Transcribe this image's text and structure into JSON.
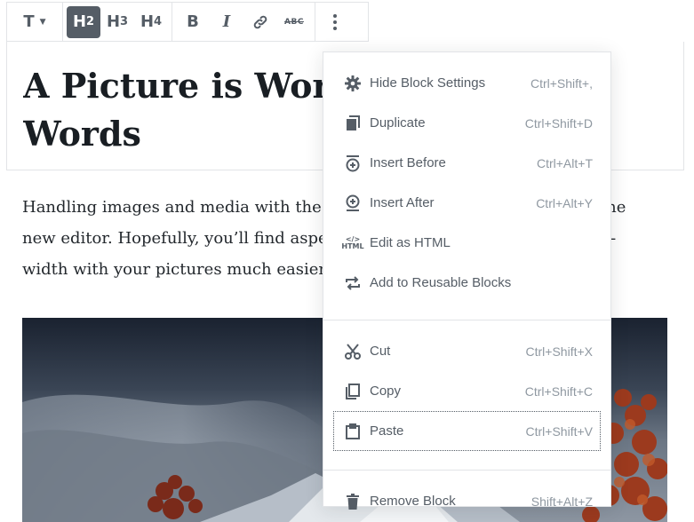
{
  "toolbar": {
    "block_type_label": "T",
    "heading_levels": [
      {
        "letter": "H",
        "level": "2",
        "active": true
      },
      {
        "letter": "H",
        "level": "3",
        "active": false
      },
      {
        "letter": "H",
        "level": "4",
        "active": false
      }
    ],
    "bold_label": "B",
    "italic_label": "I",
    "strikethrough_label": "ABC"
  },
  "heading": {
    "line1": "A Picture is Worth a Thousand",
    "line2": "Words"
  },
  "paragraph": {
    "line1": "Handling images and media with the utmost care is a primary focus of the",
    "line2": "new editor. Hopefully, you’ll find aspects of adding captions or going full-",
    "line3": "width with your pictures much easier and robust than before."
  },
  "menu": {
    "sections": [
      [
        {
          "icon": "gear-icon",
          "label": "Hide Block Settings",
          "shortcut": "Ctrl+Shift+,"
        },
        {
          "icon": "duplicate-icon",
          "label": "Duplicate",
          "shortcut": "Ctrl+Shift+D"
        },
        {
          "icon": "insert-before-icon",
          "label": "Insert Before",
          "shortcut": "Ctrl+Alt+T"
        },
        {
          "icon": "insert-after-icon",
          "label": "Insert After",
          "shortcut": "Ctrl+Alt+Y"
        },
        {
          "icon": "html-icon",
          "label": "Edit as HTML",
          "shortcut": ""
        },
        {
          "icon": "reusable-icon",
          "label": "Add to Reusable Blocks",
          "shortcut": ""
        }
      ],
      [
        {
          "icon": "scissors-icon",
          "label": "Cut",
          "shortcut": "Ctrl+Shift+X"
        },
        {
          "icon": "copy-icon",
          "label": "Copy",
          "shortcut": "Ctrl+Shift+C"
        },
        {
          "icon": "clipboard-icon",
          "label": "Paste",
          "shortcut": "Ctrl+Shift+V"
        }
      ],
      [
        {
          "icon": "trash-icon",
          "label": "Remove Block",
          "shortcut": "Shift+Alt+Z"
        }
      ]
    ]
  },
  "colors": {
    "icon_gray": "#555d66",
    "shortcut_gray": "#8f98a1",
    "border": "#e2e4e7"
  }
}
